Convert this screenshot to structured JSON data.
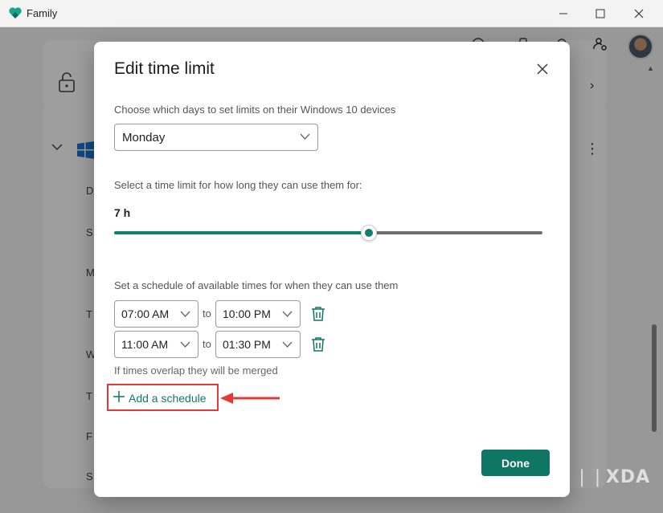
{
  "window": {
    "title": "Family"
  },
  "background": {
    "row_initials": [
      "D",
      "S",
      "M",
      "T",
      "W",
      "T",
      "F",
      "S"
    ]
  },
  "dialog": {
    "title": "Edit time limit",
    "days_label": "Choose which days to set limits on their Windows 10 devices",
    "selected_day": "Monday",
    "limit_label": "Select a time limit for how long they can use them for:",
    "limit_value": "7 h",
    "slider_fraction": 0.594,
    "schedule_label": "Set a schedule of available times for when they can use them",
    "schedules": [
      {
        "start": "07:00 AM",
        "end": "10:00 PM"
      },
      {
        "start": "11:00 AM",
        "end": "01:30 PM"
      }
    ],
    "to_text": "to",
    "merge_note": "If times overlap they will be merged",
    "add_schedule_label": "Add a schedule",
    "done_label": "Done"
  },
  "watermark": "XDA",
  "colors": {
    "accent": "#0f7663",
    "highlight": "#e53935"
  }
}
